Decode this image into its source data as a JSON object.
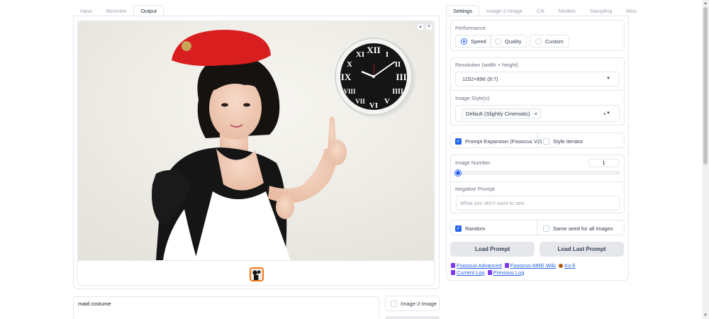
{
  "left_tabs": [
    "Input",
    "Revision",
    "Output"
  ],
  "left_active_tab": "Output",
  "gallery": {
    "download_icon": "download-icon",
    "close_icon": "close-icon",
    "clock_numerals": [
      "XII",
      "I",
      "II",
      "III",
      "IIII",
      "V",
      "VI",
      "VII",
      "VIII",
      "IX",
      "X",
      "XI"
    ]
  },
  "prompt": {
    "value": "maid costume"
  },
  "image2image_check": {
    "label": "Image-2-Image",
    "checked": false
  },
  "right_tabs": [
    "Settings",
    "Image-2-Image",
    "CN",
    "Models",
    "Sampling",
    "Misc"
  ],
  "right_active_tab": "Settings",
  "performance": {
    "label": "Performance",
    "options": [
      "Speed",
      "Quality",
      "Custom"
    ],
    "selected": "Speed"
  },
  "resolution": {
    "label": "Resolution (width × height)",
    "value": "1152×896 (9:7)"
  },
  "image_styles": {
    "label": "Image Style(s)",
    "chip": "Default (Slightly Cinematic)"
  },
  "prompt_expansion": {
    "label": "Prompt Expansion (Fooocus V2)",
    "checked": true
  },
  "style_iterator": {
    "label": "Style Iterator",
    "checked": false
  },
  "image_number": {
    "label": "Image Number",
    "value": "1",
    "slider_fraction": 0.0
  },
  "negative_prompt": {
    "label": "Negative Prompt",
    "placeholder": "What you don't want to see."
  },
  "random": {
    "label": "Random",
    "checked": true
  },
  "same_seed": {
    "label": "Same seed for all images",
    "checked": false
  },
  "buttons": {
    "load_prompt": "Load Prompt",
    "load_last_prompt": "Load Last Prompt"
  },
  "links_row1": [
    "Fooocus Advanced",
    "Fooocus-MRE Wiki",
    "Ko-fi"
  ],
  "links_row2": [
    "Current Log",
    "Previous Log"
  ],
  "colors": {
    "accent": "#2563eb",
    "thumb_border": "#f97316",
    "beret": "#d81e1e"
  }
}
